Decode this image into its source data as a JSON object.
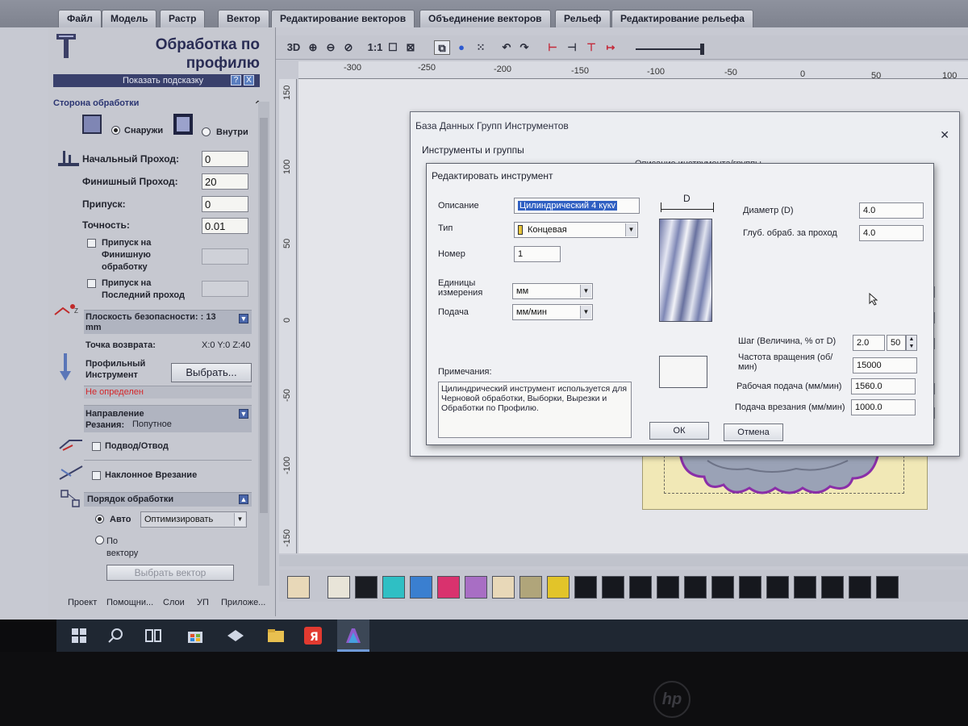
{
  "tabs": [
    "Файл",
    "Модель",
    "Растр",
    "Вектор",
    "Редактирование векторов",
    "Объединение векторов",
    "Рельеф",
    "Редактирование рельефа"
  ],
  "left_panel": {
    "title": "Обработка по профилю",
    "hint_bar": "Показать подсказку",
    "hint_btn_help": "?",
    "hint_btn_close": "X",
    "side_section": "Сторона обработки",
    "radio_outside": "Снаружи",
    "radio_inside": "Внутри",
    "start_pass_label": "Начальный Проход:",
    "start_pass_value": "0",
    "finish_pass_label": "Финишный Проход:",
    "finish_pass_value": "20",
    "allowance_label": "Припуск:",
    "allowance_value": "0",
    "accuracy_label": "Точность:",
    "accuracy_value": "0.01",
    "finish_allowance_label": "Припуск на Финишную обработку",
    "last_pass_allowance_label": "Припуск на Последний проход",
    "safe_plane_label": "Плоскость безопасности: : 13 mm",
    "return_point_label": "Точка возврата:",
    "return_point_value": "X:0 Y:0 Z:40",
    "profile_tool_label": "Профильный Инструмент",
    "select_button": "Выбрать...",
    "tool_status": "Не определен",
    "cut_direction_label": "Направление Резания:",
    "cut_direction_value": "Попутное",
    "lead_in_label": "Подвод/Отвод",
    "ramp_label": "Наклонное Врезание",
    "order_label": "Порядок обработки",
    "order_auto": "Авто",
    "order_select": "Оптимизировать",
    "order_by_vector": "По вектору",
    "select_vector_button": "Выбрать вектор",
    "bottom_tabs": [
      "Проект",
      "Помощни...",
      "Слои",
      "УП",
      "Приложе..."
    ]
  },
  "toolbar": {
    "btn_3d": "3D",
    "btn_11": "1:1"
  },
  "ruler": {
    "top": [
      "-300",
      "-250",
      "-200",
      "-150",
      "-100",
      "-50",
      "0",
      "50",
      "100"
    ],
    "left": [
      "150",
      "100",
      "50",
      "0",
      "-50",
      "-100",
      "-150"
    ]
  },
  "palette_colors": [
    "#e8e4d8",
    "#1a1c22",
    "#2fbfc4",
    "#3a7fd0",
    "#d9326e",
    "#a86ec4",
    "#e8d8b8",
    "#b0a57a",
    "#e2c429",
    "#16181e",
    "#16181e",
    "#16181e",
    "#16181e",
    "#16181e",
    "#16181e",
    "#16181e",
    "#16181e",
    "#16181e",
    "#16181e",
    "#16181e",
    "#16181e"
  ],
  "db_dialog": {
    "title": "База Данных Групп Инструментов",
    "close": "✕",
    "tools_and_groups": "Инструменты и группы",
    "tool_description_caption": "Описание инструмента/группы"
  },
  "edit_dialog": {
    "title": "Редактировать инструмент",
    "description_label": "Описание",
    "description_value": "Цилиндрический 4 кукv",
    "type_label": "Тип",
    "type_value": "Концевая",
    "number_label": "Номер",
    "number_value": "1",
    "units_label": "Единицы измерения",
    "units_value": "мм",
    "feed_label": "Подача",
    "feed_value": "мм/мин",
    "notes_label": "Примечания:",
    "notes_value": "Цилиндрический инструмент используется для Черновой обработки, Выборки, Вырезки и Обработки по Профилю.",
    "dim_label": "D",
    "diameter_label": "Диаметр (D)",
    "diameter_value": "4.0",
    "pass_depth_label": "Глуб. обраб. за проход",
    "pass_depth_value": "4.0",
    "stepover_label": "Шаг (Величина, % от D)",
    "stepover_value": "2.0",
    "stepover_percent": "50",
    "spindle_label": "Частота вращения (об/мин)",
    "spindle_value": "15000",
    "feed_rate_label": "Рабочая подача (мм/мин)",
    "feed_rate_value": "1560.0",
    "plunge_label": "Подача врезания (мм/мин)",
    "plunge_value": "1000.0",
    "ok_button": "ОК",
    "cancel_button": "Отмена"
  },
  "taskbar_icons": [
    "windows-start-icon",
    "search-icon",
    "task-view-icon",
    "store-icon",
    "mail-icon",
    "explorer-icon",
    "yandex-browser-icon",
    "artcam-icon"
  ]
}
